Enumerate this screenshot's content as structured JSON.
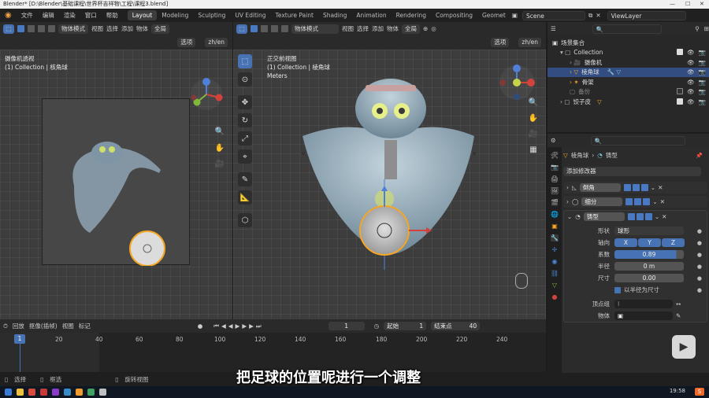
{
  "window": {
    "title": "Blender* [D:\\Blender\\基础课程\\世界杯吉祥物\\工程\\课程3.blend]"
  },
  "menu": {
    "items": [
      "文件",
      "编辑",
      "渲染",
      "窗口",
      "帮助"
    ],
    "workspaces": [
      "Layout",
      "Modeling",
      "Sculpting",
      "UV Editing",
      "Texture Paint",
      "Shading",
      "Animation",
      "Rendering",
      "Compositing",
      "Geomet"
    ],
    "active_workspace": "Layout",
    "scene": "Scene",
    "view_layer": "ViewLayer"
  },
  "left_view": {
    "mode": "物体模式",
    "menus": [
      "视图",
      "选择",
      "添加",
      "物体"
    ],
    "orientation": "全局",
    "options": "选项",
    "lang": "zh/en",
    "info_line1": "摄像机透视",
    "info_line2": "(1) Collection | 核角球"
  },
  "main_view": {
    "mode": "物体模式",
    "menus": [
      "视图",
      "选择",
      "添加",
      "物体"
    ],
    "orientation": "全局",
    "options": "选项",
    "lang": "zh/en",
    "info_line1": "正交前视图",
    "info_line2": "(1) Collection | 棱角球",
    "info_line3": "Meters"
  },
  "outliner": {
    "root": "场景集合",
    "rows": [
      {
        "label": "Collection",
        "indent": 1,
        "selected": false
      },
      {
        "label": "摄像机",
        "indent": 2,
        "selected": false
      },
      {
        "label": "棱角球",
        "indent": 2,
        "selected": true
      },
      {
        "label": "骨架",
        "indent": 2,
        "selected": false
      },
      {
        "label": "备份",
        "indent": 1,
        "selected": false
      },
      {
        "label": "饺子皮",
        "indent": 1,
        "selected": false
      }
    ]
  },
  "properties": {
    "breadcrumb_object": "棱角球",
    "breadcrumb_tab": "铸型",
    "add_modifier": "添加修改器",
    "modifiers": [
      {
        "name": "倒角"
      },
      {
        "name": "细分"
      },
      {
        "name": "铸型"
      }
    ],
    "cast": {
      "shape_label": "形状",
      "shape_value": "球形",
      "axis_label": "轴向",
      "axes": [
        "X",
        "Y",
        "Z"
      ],
      "factor_label": "系数",
      "factor_value": "0.89",
      "radius_label": "半径",
      "radius_value": "0 m",
      "size_label": "尺寸",
      "size_value": "0.00",
      "use_radius_label": "以半径为尺寸",
      "vertex_group_label": "顶点组",
      "object_label": "物体"
    }
  },
  "timeline": {
    "menus": [
      "回放",
      "抠像(插帧)",
      "视图",
      "标记"
    ],
    "current_frame": "1",
    "start_label": "起始",
    "start_value": "1",
    "end_label": "结束点",
    "end_value": "40",
    "ticks": [
      "1",
      "20",
      "40",
      "60",
      "80",
      "100",
      "120",
      "140",
      "160",
      "180",
      "200",
      "220",
      "240"
    ]
  },
  "statusbar": {
    "items": [
      "选择",
      "框选",
      "旋转视图"
    ]
  },
  "taskbar": {
    "time": "19:58"
  },
  "subtitle": "把足球的位置呢进行一个调整",
  "colors": {
    "accent": "#4772b3",
    "selection": "#334d80",
    "active_orange": "#f5a623"
  }
}
